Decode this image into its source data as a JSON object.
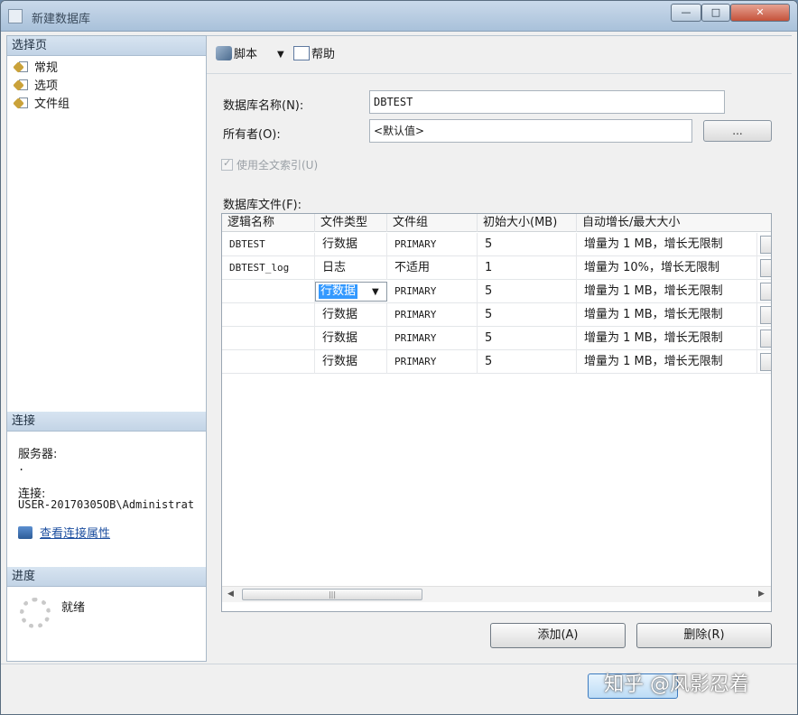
{
  "window": {
    "title": "新建数据库",
    "min_glyph": "—",
    "max_glyph": "□",
    "close_glyph": "✕"
  },
  "left": {
    "select_page_header": "选择页",
    "pages": [
      {
        "label": "常规",
        "icon": "settings-page-icon"
      },
      {
        "label": "选项",
        "icon": "settings-page-icon"
      },
      {
        "label": "文件组",
        "icon": "settings-page-icon"
      }
    ],
    "connection_header": "连接",
    "server_label": "服务器:",
    "server_value": ".",
    "connection_label": "连接:",
    "connection_value": "USER-20170305OB\\Administrat",
    "view_connection_properties": "查看连接属性",
    "progress_header": "进度",
    "progress_status": "就绪"
  },
  "toolbar": {
    "script_label": "脚本",
    "script_caret": "▼",
    "help_label": "帮助"
  },
  "form": {
    "db_name_label": "数据库名称(N):",
    "db_name_value": "DBTEST",
    "owner_label": "所有者(O):",
    "owner_value": "<默认值>",
    "browse_button": "...",
    "fulltext_label": "使用全文索引(U)",
    "db_files_label": "数据库文件(F):"
  },
  "grid": {
    "headers": [
      "逻辑名称",
      "文件类型",
      "文件组",
      "初始大小(MB)",
      "自动增长/最大大小"
    ],
    "rows": [
      {
        "name": "DBTEST",
        "type": "行数据",
        "filegroup": "PRIMARY",
        "size": "5",
        "growth": "增量为 1 MB，增长无限制"
      },
      {
        "name": "DBTEST_log",
        "type": "日志",
        "filegroup": "不适用",
        "size": "1",
        "growth": "增量为 10%，增长无限制"
      },
      {
        "name": "",
        "type": "行数据",
        "filegroup": "PRIMARY",
        "size": "5",
        "growth": "增量为 1 MB，增长无限制"
      },
      {
        "name": "",
        "type": "行数据",
        "filegroup": "PRIMARY",
        "size": "5",
        "growth": "增量为 1 MB，增长无限制"
      },
      {
        "name": "",
        "type": "行数据",
        "filegroup": "PRIMARY",
        "size": "5",
        "growth": "增量为 1 MB，增长无限制"
      },
      {
        "name": "",
        "type": "行数据",
        "filegroup": "PRIMARY",
        "size": "5",
        "growth": "增量为 1 MB，增长无限制"
      }
    ],
    "combo_arrow": "▼",
    "scroll_left": "◀",
    "scroll_right": "▶",
    "scroll_grip": "|||"
  },
  "buttons": {
    "add": "添加(A)",
    "delete": "删除(R)"
  },
  "watermark": "知乎 @风影忍着",
  "colors": {
    "selection": "#3399ff",
    "link": "#1d4fa0",
    "header_bar": "#c3d4e6"
  }
}
